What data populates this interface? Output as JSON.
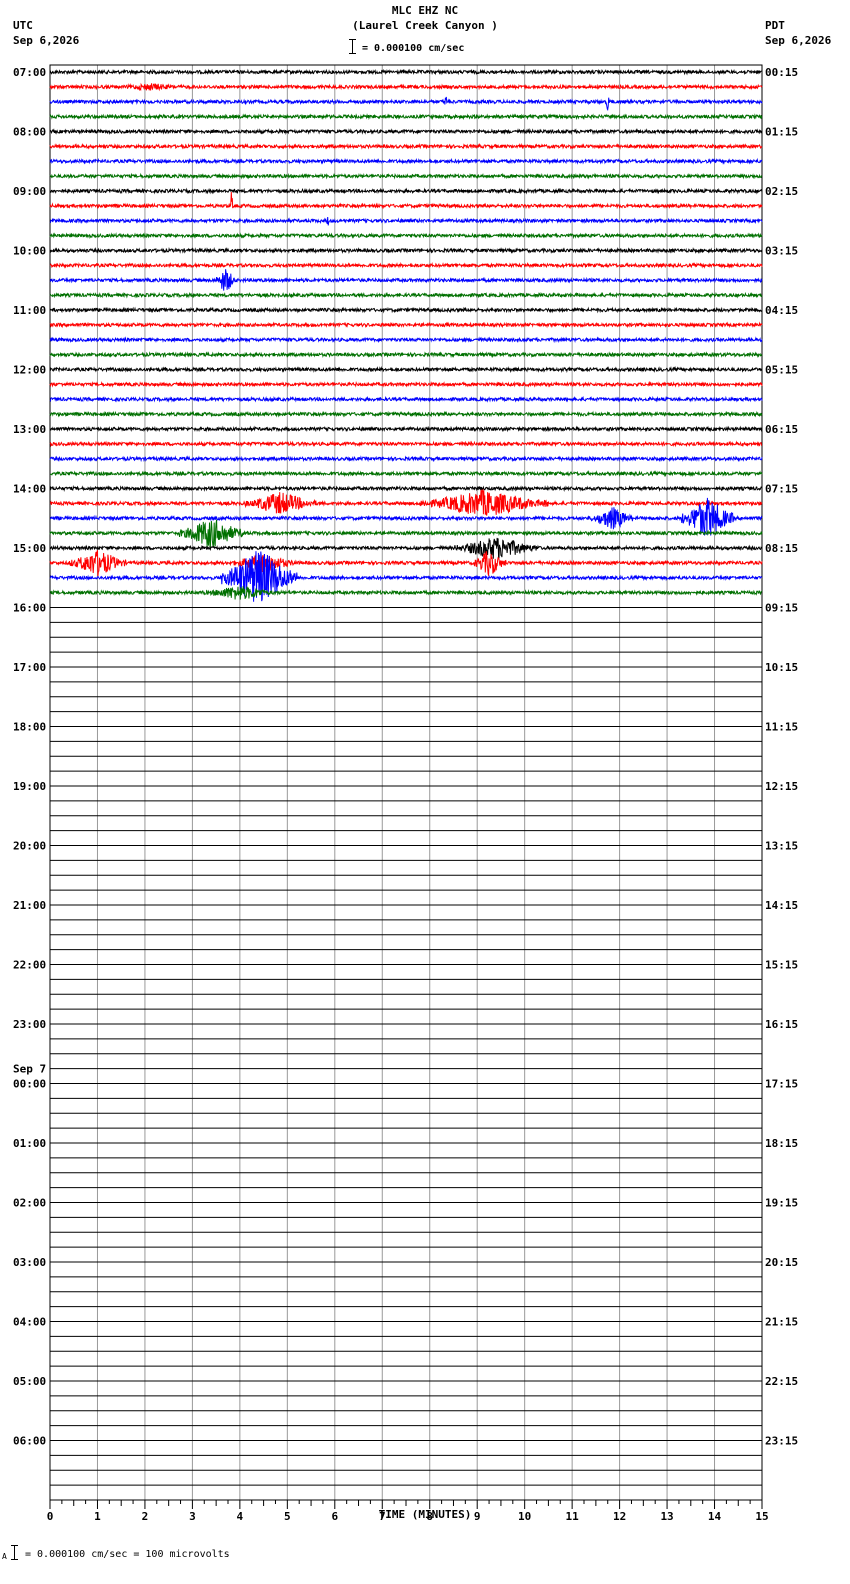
{
  "header": {
    "station": "MLC EHZ NC",
    "location": "(Laurel Creek Canyon )",
    "scale_text": "= 0.000100 cm/sec",
    "left_zone": "UTC",
    "left_date": "Sep 6,2026",
    "right_zone": "PDT",
    "right_date": "Sep 6,2026"
  },
  "footer": {
    "prefix": "A",
    "text": "= 0.000100 cm/sec =     100 microvolts"
  },
  "chart_data": {
    "type": "line",
    "xlabel": "TIME (MINUTES)",
    "xlim": [
      0,
      15
    ],
    "x_ticks": [
      "0",
      "1",
      "2",
      "3",
      "4",
      "5",
      "6",
      "7",
      "8",
      "9",
      "10",
      "11",
      "12",
      "13",
      "14",
      "15"
    ],
    "trace_colors": [
      "#000000",
      "#ff0000",
      "#0000ff",
      "#007000"
    ],
    "traces_per_hour": 4,
    "recorded_traces": 36,
    "left_labels": [
      "07:00",
      "08:00",
      "09:00",
      "10:00",
      "11:00",
      "12:00",
      "13:00",
      "14:00",
      "15:00",
      "16:00",
      "17:00",
      "18:00",
      "19:00",
      "20:00",
      "21:00",
      "22:00",
      "23:00",
      "00:00",
      "01:00",
      "02:00",
      "03:00",
      "04:00",
      "05:00",
      "06:00"
    ],
    "day_change": {
      "hour_index": 17,
      "label": "Sep 7"
    },
    "right_labels": [
      "00:15",
      "01:15",
      "02:15",
      "03:15",
      "04:15",
      "05:15",
      "06:15",
      "07:15",
      "08:15",
      "09:15",
      "10:15",
      "11:15",
      "12:15",
      "13:15",
      "14:15",
      "15:15",
      "16:15",
      "17:15",
      "18:15",
      "19:15",
      "20:15",
      "21:15",
      "22:15",
      "23:15"
    ],
    "events": [
      {
        "trace": 1,
        "start": 1.3,
        "end": 2.9,
        "amp": 4
      },
      {
        "trace": 2,
        "start": 8.3,
        "end": 8.4,
        "amp": 8
      },
      {
        "trace": 2,
        "start": 11.7,
        "end": 11.8,
        "amp": 9
      },
      {
        "trace": 9,
        "start": 3.8,
        "end": 3.85,
        "amp": 18
      },
      {
        "trace": 10,
        "start": 5.8,
        "end": 5.9,
        "amp": 6
      },
      {
        "trace": 14,
        "start": 3.5,
        "end": 3.9,
        "amp": 14
      },
      {
        "trace": 29,
        "start": 4.1,
        "end": 5.6,
        "amp": 12
      },
      {
        "trace": 29,
        "start": 7.8,
        "end": 10.5,
        "amp": 14
      },
      {
        "trace": 30,
        "start": 11.4,
        "end": 12.3,
        "amp": 12
      },
      {
        "trace": 30,
        "start": 13.3,
        "end": 14.4,
        "amp": 22
      },
      {
        "trace": 31,
        "start": 2.7,
        "end": 4.1,
        "amp": 16
      },
      {
        "trace": 32,
        "start": 8.5,
        "end": 10.3,
        "amp": 12
      },
      {
        "trace": 33,
        "start": 0.4,
        "end": 1.6,
        "amp": 14
      },
      {
        "trace": 33,
        "start": 3.8,
        "end": 5.2,
        "amp": 10
      },
      {
        "trace": 33,
        "start": 8.9,
        "end": 9.6,
        "amp": 14
      },
      {
        "trace": 34,
        "start": 3.6,
        "end": 5.2,
        "amp": 30
      },
      {
        "trace": 35,
        "start": 3.2,
        "end": 4.8,
        "amp": 8
      }
    ]
  }
}
